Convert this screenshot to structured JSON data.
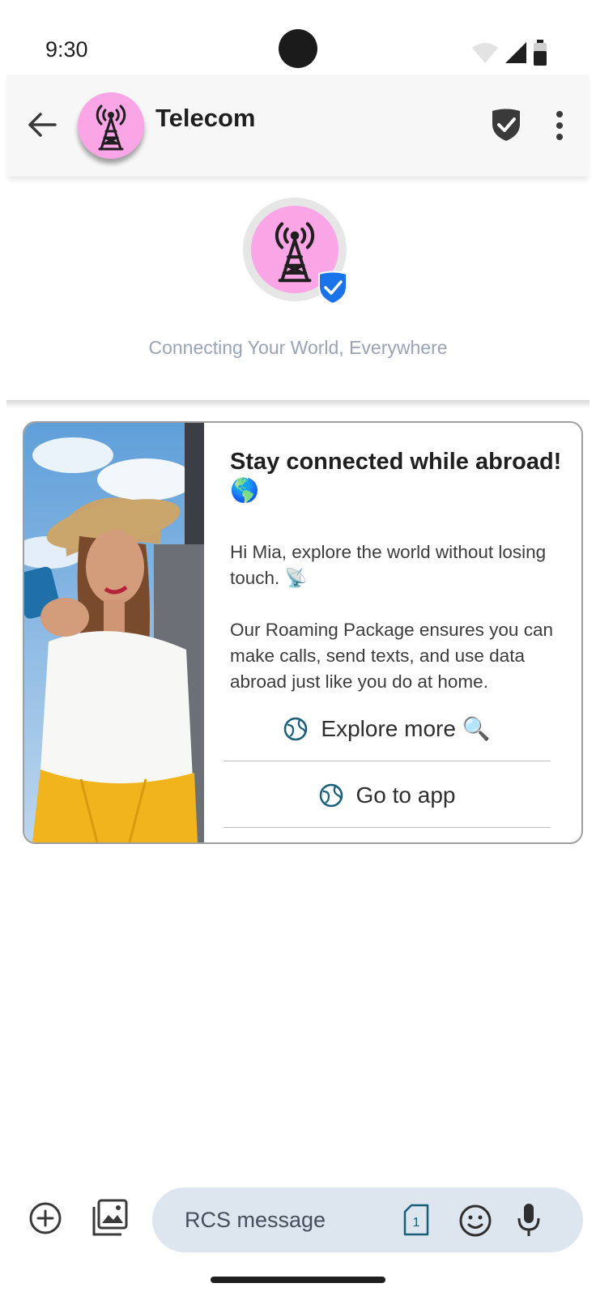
{
  "status_bar": {
    "time": "9:30"
  },
  "header": {
    "title": "Telecom"
  },
  "profile": {
    "tagline": "Connecting Your World, Everywhere"
  },
  "card": {
    "title": "Stay connected while abroad! 🌎",
    "description": "Hi Mia, explore the world without losing touch. 📡\n\nOur Roaming Package ensures you can make calls, send texts, and use data abroad just like you do at home.",
    "actions": [
      {
        "label": "Explore more 🔍",
        "icon": "globe-icon"
      },
      {
        "label": "Go to app",
        "icon": "globe-icon"
      }
    ]
  },
  "composer": {
    "placeholder": "RCS message",
    "sim_number": "1"
  },
  "colors": {
    "avatar_bg": "#f9a5e6",
    "verified_blue": "#1a73e8",
    "action_icon": "#1a5f7a",
    "composer_bg": "#dde6ef"
  }
}
